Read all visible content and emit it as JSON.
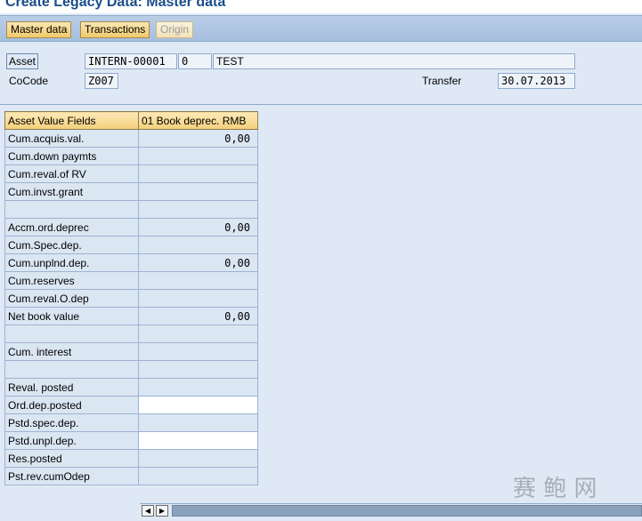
{
  "window": {
    "title": "Create Legacy Data: Master data"
  },
  "toolbar": {
    "master_data": "Master data",
    "transactions": "Transactions",
    "origin": "Origin"
  },
  "header": {
    "asset_label": "Asset",
    "asset_number": "INTERN-00001",
    "asset_subnumber": "0",
    "asset_description": "TEST",
    "cocode_label": "CoCode",
    "cocode_value": "Z007",
    "transfer_label": "Transfer",
    "transfer_value": "30.07.2013"
  },
  "table": {
    "headers": [
      "Asset Value Fields",
      "01 Book deprec. RMB"
    ],
    "rows": [
      {
        "field": "Cum.acquis.val.",
        "value": "0,00"
      },
      {
        "field": "Cum.down paymts",
        "value": ""
      },
      {
        "field": "Cum.reval.of RV",
        "value": ""
      },
      {
        "field": "Cum.invst.grant",
        "value": ""
      },
      {
        "field": "",
        "value": ""
      },
      {
        "field": "Accm.ord.deprec",
        "value": "0,00"
      },
      {
        "field": "Cum.Spec.dep.",
        "value": ""
      },
      {
        "field": "Cum.unplnd.dep.",
        "value": "0,00"
      },
      {
        "field": "Cum.reserves",
        "value": ""
      },
      {
        "field": "Cum.reval.O.dep",
        "value": ""
      },
      {
        "field": "Net book value",
        "value": "0,00"
      },
      {
        "field": "",
        "value": ""
      },
      {
        "field": "Cum. interest",
        "value": ""
      },
      {
        "field": "",
        "value": ""
      },
      {
        "field": "Reval. posted",
        "value": ""
      },
      {
        "field": "Ord.dep.posted",
        "value": ""
      },
      {
        "field": "Pstd.spec.dep.",
        "value": ""
      },
      {
        "field": "Pstd.unpl.dep.",
        "value": ""
      },
      {
        "field": "Res.posted",
        "value": ""
      },
      {
        "field": "Pst.rev.cumOdep",
        "value": ""
      }
    ]
  },
  "icons": {
    "scroll_left": "arrow-left-icon",
    "scroll_right": "arrow-right-icon"
  },
  "watermark": {
    "text": "赛 鲍 网"
  }
}
